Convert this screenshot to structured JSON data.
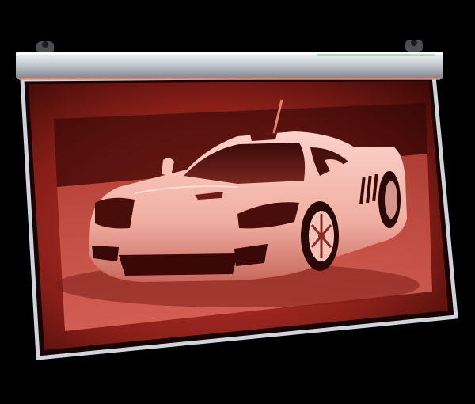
{
  "scene": {
    "subject": "led-edge-lit-acrylic-sign",
    "engraved_image": "white-supercar-front-three-quarter",
    "colors": {
      "background": "#000000",
      "glow": "#e8463c",
      "glow_dark": "#5a0f0c",
      "rail_light": "#d8dde3",
      "rail_dark": "#7c8288",
      "frame_edge": "#c9ced4",
      "car_body": "#f4b7ac",
      "car_shadow": "#b5544a",
      "tire": "#2a0806"
    }
  }
}
